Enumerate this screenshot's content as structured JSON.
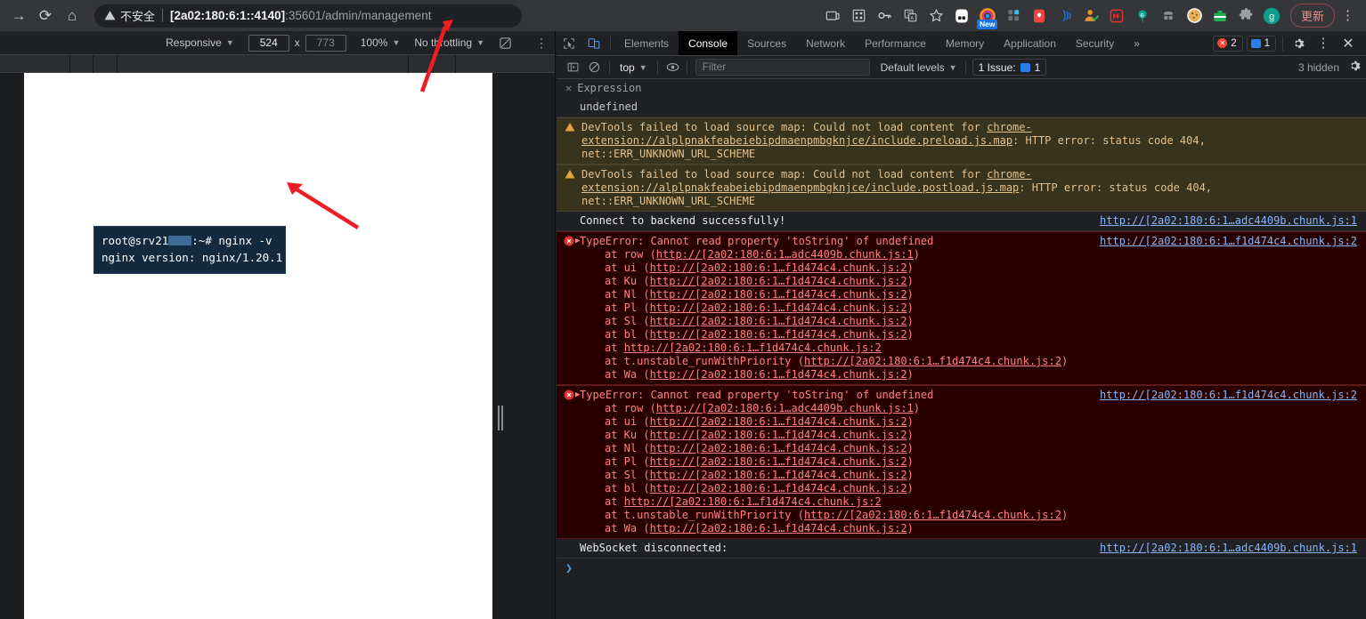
{
  "browser": {
    "nav": [
      {
        "name": "forward-button",
        "glyph": "→"
      },
      {
        "name": "reload-button",
        "glyph": "⟳"
      },
      {
        "name": "home-button",
        "glyph": "⌂"
      }
    ],
    "omnibox": {
      "security_label": "不安全",
      "security_icon": "warning-triangle-icon",
      "url_host": "[2a02:180:6:1::4140]",
      "url_rest": ":35601/admin/management"
    },
    "toolbar_icons": [
      {
        "name": "cast-icon",
        "glyph": "▭"
      },
      {
        "name": "qr-code-icon",
        "glyph": "▦"
      },
      {
        "name": "password-key-icon",
        "glyph": "⚷"
      },
      {
        "name": "translate-icon",
        "glyph": "文"
      },
      {
        "name": "bookmark-star-icon",
        "glyph": "☆"
      },
      {
        "name": "extension-pocketbook-icon",
        "glyph": "oo"
      },
      {
        "name": "extension-rainbow-icon",
        "glyph": "◍",
        "badge": "New"
      },
      {
        "name": "extension-grid-icon",
        "glyph": "▚"
      },
      {
        "name": "extension-shield-icon",
        "glyph": "🛡"
      },
      {
        "name": "extension-wifi-icon",
        "glyph": "))"
      },
      {
        "name": "extension-user-check-icon",
        "glyph": "👤"
      },
      {
        "name": "extension-fastforward-icon",
        "glyph": "⏩"
      },
      {
        "name": "extension-e-icon",
        "glyph": "e"
      },
      {
        "name": "extension-spy-icon",
        "glyph": "🕵"
      },
      {
        "name": "extension-cookie-icon",
        "glyph": "🍪"
      },
      {
        "name": "extension-toolbox-icon",
        "glyph": "🧰"
      },
      {
        "name": "extensions-puzzle-icon",
        "glyph": "🧩"
      },
      {
        "name": "profile-avatar",
        "glyph": "g"
      }
    ],
    "update_button_label": "更新",
    "menu_icon": "kebab-menu-icon"
  },
  "device_toolbar": {
    "device_select": "Responsive",
    "width_value": "524",
    "x_separator": "x",
    "height_placeholder": "773",
    "zoom_select": "100%",
    "throttling_select": "No throttling",
    "rotate_icon": "rotate-device-icon",
    "more_icon": "more-options-icon"
  },
  "viewport": {
    "terminal_tooltip": {
      "line1_prefix": "root@srv21",
      "line1_suffix": ":~# nginx -v",
      "line2": "nginx version: nginx/1.20.1"
    },
    "resize_handle": "viewport-resize-handle"
  },
  "devtools": {
    "inspect_icon": "inspect-element-icon",
    "device_toggle_icon": "toggle-device-toolbar-icon",
    "tabs": [
      {
        "label": "Elements",
        "active": false
      },
      {
        "label": "Console",
        "active": true
      },
      {
        "label": "Sources",
        "active": false
      },
      {
        "label": "Network",
        "active": false
      },
      {
        "label": "Performance",
        "active": false
      },
      {
        "label": "Memory",
        "active": false
      },
      {
        "label": "Application",
        "active": false
      },
      {
        "label": "Security",
        "active": false
      }
    ],
    "overflow_label": "»",
    "error_count": "2",
    "message_count": "1",
    "settings_icon": "gear-icon",
    "more_icon": "more-tools-icon",
    "close_icon": "close-icon",
    "console_toolbar": {
      "sidebar_icon": "console-sidebar-icon",
      "clear_icon": "clear-console-icon",
      "context_select": "top",
      "eye_icon": "live-expression-icon",
      "filter_placeholder": "Filter",
      "levels_select": "Default levels",
      "issues_label": "1 Issue:",
      "issues_count": "1",
      "hidden_label": "3 hidden",
      "settings_icon": "console-settings-icon"
    }
  },
  "console": {
    "eval_expression": "Expression",
    "eval_result": "undefined",
    "entries": [
      {
        "type": "warning",
        "text_before": "DevTools failed to load source map: Could not load content for ",
        "link": "chrome-extension://alplpnakfeabeiebipdmaenpmbgknjce/include.preload.js.map",
        "text_after": ": HTTP error: status code 404, net::ERR_UNKNOWN_URL_SCHEME"
      },
      {
        "type": "warning",
        "text_before": "DevTools failed to load source map: Could not load content for ",
        "link": "chrome-extension://alplpnakfeabeiebipdmaenpmbgknjce/include.postload.js.map",
        "text_after": ": HTTP error: status code 404, net::ERR_UNKNOWN_URL_SCHEME"
      },
      {
        "type": "info",
        "message": "Connect to backend successfully!",
        "source": "http://[2a02:180:6:1…adc4409b.chunk.js:1"
      },
      {
        "type": "error",
        "title": "TypeError: Cannot read property 'toString' of undefined",
        "source": "http://[2a02:180:6:1…f1d474c4.chunk.js:2",
        "stack": [
          {
            "fn": "at row (",
            "link": "http://[2a02:180:6:1…adc4409b.chunk.js:1",
            "close": ")"
          },
          {
            "fn": "at ui (",
            "link": "http://[2a02:180:6:1…f1d474c4.chunk.js:2",
            "close": ")"
          },
          {
            "fn": "at Ku (",
            "link": "http://[2a02:180:6:1…f1d474c4.chunk.js:2",
            "close": ")"
          },
          {
            "fn": "at Nl (",
            "link": "http://[2a02:180:6:1…f1d474c4.chunk.js:2",
            "close": ")"
          },
          {
            "fn": "at Pl (",
            "link": "http://[2a02:180:6:1…f1d474c4.chunk.js:2",
            "close": ")"
          },
          {
            "fn": "at Sl (",
            "link": "http://[2a02:180:6:1…f1d474c4.chunk.js:2",
            "close": ")"
          },
          {
            "fn": "at bl (",
            "link": "http://[2a02:180:6:1…f1d474c4.chunk.js:2",
            "close": ")"
          },
          {
            "fn": "at ",
            "link": "http://[2a02:180:6:1…f1d474c4.chunk.js:2",
            "close": ""
          },
          {
            "fn": "at t.unstable_runWithPriority (",
            "link": "http://[2a02:180:6:1…f1d474c4.chunk.js:2",
            "close": ")"
          },
          {
            "fn": "at Wa (",
            "link": "http://[2a02:180:6:1…f1d474c4.chunk.js:2",
            "close": ")"
          }
        ]
      },
      {
        "type": "error",
        "title": "TypeError: Cannot read property 'toString' of undefined",
        "source": "http://[2a02:180:6:1…f1d474c4.chunk.js:2",
        "stack": [
          {
            "fn": "at row (",
            "link": "http://[2a02:180:6:1…adc4409b.chunk.js:1",
            "close": ")"
          },
          {
            "fn": "at ui (",
            "link": "http://[2a02:180:6:1…f1d474c4.chunk.js:2",
            "close": ")"
          },
          {
            "fn": "at Ku (",
            "link": "http://[2a02:180:6:1…f1d474c4.chunk.js:2",
            "close": ")"
          },
          {
            "fn": "at Nl (",
            "link": "http://[2a02:180:6:1…f1d474c4.chunk.js:2",
            "close": ")"
          },
          {
            "fn": "at Pl (",
            "link": "http://[2a02:180:6:1…f1d474c4.chunk.js:2",
            "close": ")"
          },
          {
            "fn": "at Sl (",
            "link": "http://[2a02:180:6:1…f1d474c4.chunk.js:2",
            "close": ")"
          },
          {
            "fn": "at bl (",
            "link": "http://[2a02:180:6:1…f1d474c4.chunk.js:2",
            "close": ")"
          },
          {
            "fn": "at ",
            "link": "http://[2a02:180:6:1…f1d474c4.chunk.js:2",
            "close": ""
          },
          {
            "fn": "at t.unstable_runWithPriority (",
            "link": "http://[2a02:180:6:1…f1d474c4.chunk.js:2",
            "close": ")"
          },
          {
            "fn": "at Wa (",
            "link": "http://[2a02:180:6:1…f1d474c4.chunk.js:2",
            "close": ")"
          }
        ]
      },
      {
        "type": "ws",
        "message": "WebSocket disconnected:",
        "source": "http://[2a02:180:6:1…adc4409b.chunk.js:1"
      }
    ],
    "prompt_glyph": "❯"
  },
  "annotations": {
    "arrow_color": "#ee1c25",
    "arrow1": "points at address bar",
    "arrow2": "points at terminal tooltip"
  }
}
